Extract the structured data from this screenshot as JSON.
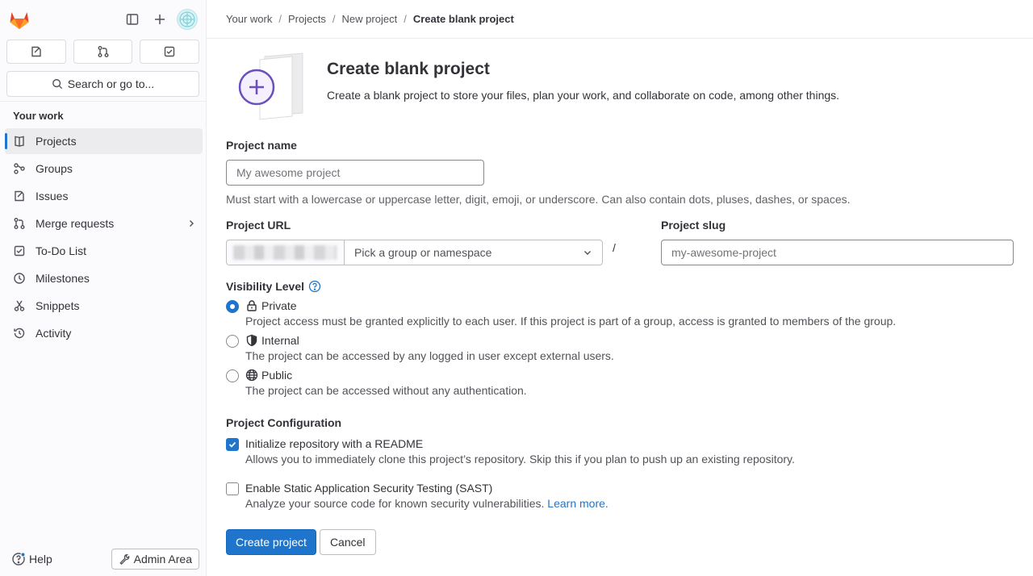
{
  "sidebar": {
    "search_label": "Search or go to...",
    "section_title": "Your work",
    "items": [
      {
        "label": "Projects",
        "icon": "project-icon",
        "active": true
      },
      {
        "label": "Groups",
        "icon": "group-icon"
      },
      {
        "label": "Issues",
        "icon": "issues-icon"
      },
      {
        "label": "Merge requests",
        "icon": "merge-request-icon",
        "has_chevron": true
      },
      {
        "label": "To-Do List",
        "icon": "todo-icon"
      },
      {
        "label": "Milestones",
        "icon": "milestone-icon"
      },
      {
        "label": "Snippets",
        "icon": "snippet-icon"
      },
      {
        "label": "Activity",
        "icon": "history-icon"
      }
    ],
    "help_label": "Help",
    "admin_label": "Admin Area"
  },
  "breadcrumb": {
    "items": [
      "Your work",
      "Projects",
      "New project"
    ],
    "current": "Create blank project"
  },
  "header": {
    "title": "Create blank project",
    "description": "Create a blank project to store your files, plan your work, and collaborate on code, among other things."
  },
  "form": {
    "project_name_label": "Project name",
    "project_name_placeholder": "My awesome project",
    "project_name_help": "Must start with a lowercase or uppercase letter, digit, emoji, or underscore. Can also contain dots, pluses, dashes, or spaces.",
    "project_url_label": "Project URL",
    "namespace_placeholder": "Pick a group or namespace",
    "slash": "/",
    "project_slug_label": "Project slug",
    "project_slug_placeholder": "my-awesome-project",
    "visibility_label": "Visibility Level",
    "visibility_options": [
      {
        "label": "Private",
        "description": "Project access must be granted explicitly to each user. If this project is part of a group, access is granted to members of the group.",
        "icon": "lock-icon",
        "checked": true
      },
      {
        "label": "Internal",
        "description": "The project can be accessed by any logged in user except external users.",
        "icon": "shield-icon",
        "checked": false
      },
      {
        "label": "Public",
        "description": "The project can be accessed without any authentication.",
        "icon": "earth-icon",
        "checked": false
      }
    ],
    "config_label": "Project Configuration",
    "readme_label": "Initialize repository with a README",
    "readme_desc": "Allows you to immediately clone this project’s repository. Skip this if you plan to push up an existing repository.",
    "readme_checked": true,
    "sast_label": "Enable Static Application Security Testing (SAST)",
    "sast_desc": "Analyze your source code for known security vulnerabilities.",
    "sast_link": "Learn more.",
    "sast_checked": false
  },
  "actions": {
    "create_label": "Create project",
    "cancel_label": "Cancel"
  },
  "colors": {
    "primary": "#1f75cb",
    "logo_orange": "#e24329",
    "illustration_purple": "#6b4fbb"
  }
}
